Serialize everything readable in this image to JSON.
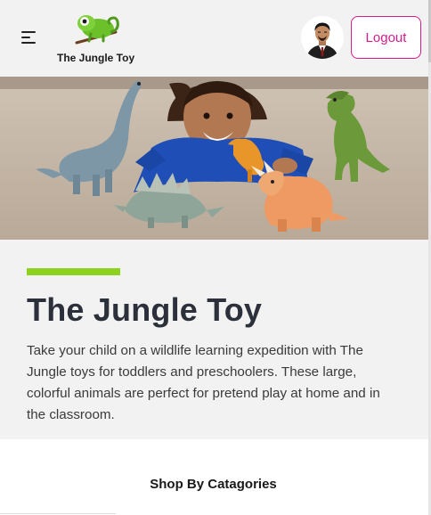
{
  "header": {
    "brand_name": "The Jungle Toy",
    "logout_label": "Logout"
  },
  "hero": {
    "icon": "hero-banner-image"
  },
  "intro": {
    "title": "The Jungle Toy",
    "description": "Take your child on a wildlife learning expedition with The Jungle toys for toddlers and preschoolers. These large, colorful animals are perfect for pretend play at home and in the classroom."
  },
  "categories": {
    "heading": "Shop By Catagories"
  },
  "colors": {
    "accent": "#8cd21e",
    "logout": "#d81b8c",
    "title": "#2b303b",
    "panel_bg": "#f2f2f2"
  }
}
